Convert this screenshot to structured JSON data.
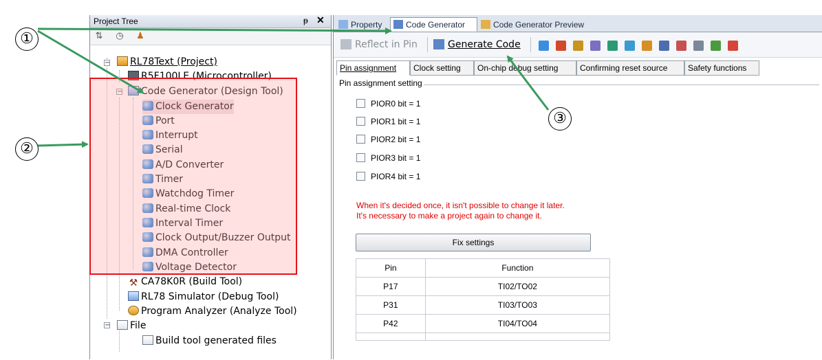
{
  "project_tree": {
    "title": "Project Tree",
    "pin_glyph": "ᵽ",
    "close_glyph": "✕",
    "items": [
      {
        "label": "RL78Text (Project)",
        "icon": "project-icon"
      },
      {
        "label": "R5F100LE (Microcontroller)",
        "icon": "microcontroller-icon"
      },
      {
        "label": "Code Generator (Design Tool)",
        "icon": "code-generator-icon"
      },
      {
        "label": "Clock Generator",
        "icon": "clock-generator-icon"
      },
      {
        "label": "Port",
        "icon": "module-icon"
      },
      {
        "label": "Interrupt",
        "icon": "module-icon"
      },
      {
        "label": "Serial",
        "icon": "module-icon"
      },
      {
        "label": "A/D Converter",
        "icon": "module-icon"
      },
      {
        "label": "Timer",
        "icon": "module-icon"
      },
      {
        "label": "Watchdog Timer",
        "icon": "module-icon"
      },
      {
        "label": "Real-time Clock",
        "icon": "module-icon"
      },
      {
        "label": "Interval Timer",
        "icon": "module-icon"
      },
      {
        "label": "Clock Output/Buzzer Output",
        "icon": "module-icon"
      },
      {
        "label": "DMA Controller",
        "icon": "module-icon"
      },
      {
        "label": "Voltage Detector",
        "icon": "module-icon"
      },
      {
        "label": "CA78K0R (Build Tool)",
        "icon": "build-tool-icon"
      },
      {
        "label": "RL78 Simulator (Debug Tool)",
        "icon": "debug-tool-icon"
      },
      {
        "label": "Program Analyzer (Analyze Tool)",
        "icon": "analyze-tool-icon"
      },
      {
        "label": "File",
        "icon": "file-folder-icon"
      },
      {
        "label": "Build tool generated files",
        "icon": "generated-files-icon"
      }
    ]
  },
  "tabs": [
    {
      "label": "Property"
    },
    {
      "label": "Code Generator"
    },
    {
      "label": "Code Generator Preview"
    }
  ],
  "toolbar": {
    "reflect_label": "Reflect in Pin",
    "generate_label": "Generate Code"
  },
  "subtabs": [
    "Pin assignment",
    "Clock setting",
    "On-chip debug setting",
    "Confirming reset source",
    "Safety functions"
  ],
  "pin_assignment": {
    "group_title": "Pin assignment setting",
    "checkboxes": [
      "PIOR0 bit = 1",
      "PIOR1 bit = 1",
      "PIOR2 bit = 1",
      "PIOR3 bit = 1",
      "PIOR4 bit = 1"
    ],
    "warning_line1": "When it's decided once, it isn't possible to change it later.",
    "warning_line2": "It's necessary to make a project again to change it.",
    "fix_button": "Fix settings",
    "table": {
      "headers": [
        "Pin",
        "Function"
      ],
      "rows": [
        [
          "P17",
          "TI02/TO02"
        ],
        [
          "P31",
          "TI03/TO03"
        ],
        [
          "P42",
          "TI04/TO04"
        ]
      ]
    }
  },
  "callouts": [
    "①",
    "②",
    "③"
  ],
  "colors": {
    "highlight_border": "#e3131b",
    "arrow": "#3a9a5e",
    "warning": "#e00000"
  }
}
